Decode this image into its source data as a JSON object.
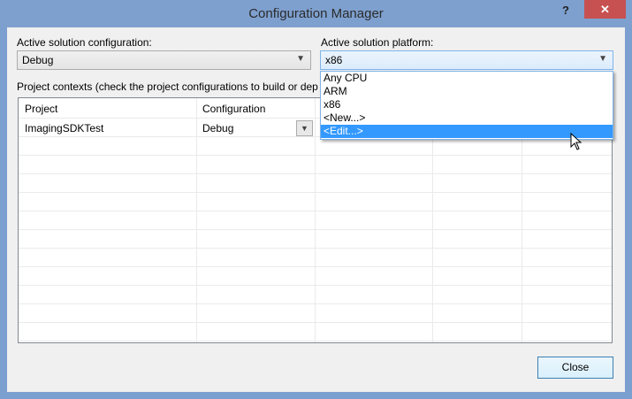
{
  "window": {
    "title": "Configuration Manager",
    "help": "?",
    "close": "✕"
  },
  "active_config": {
    "label": "Active solution configuration:",
    "value": "Debug"
  },
  "active_platform": {
    "label": "Active solution platform:",
    "value": "x86",
    "options": [
      "Any CPU",
      "ARM",
      "x86",
      "<New...>",
      "<Edit...>"
    ],
    "highlighted_index": 4
  },
  "contexts_label": "Project contexts (check the project configurations to build or dep",
  "table": {
    "headers": [
      "Project",
      "Configuration"
    ],
    "rows": [
      {
        "project": "ImagingSDKTest",
        "configuration": "Debug"
      }
    ]
  },
  "buttons": {
    "close": "Close"
  }
}
